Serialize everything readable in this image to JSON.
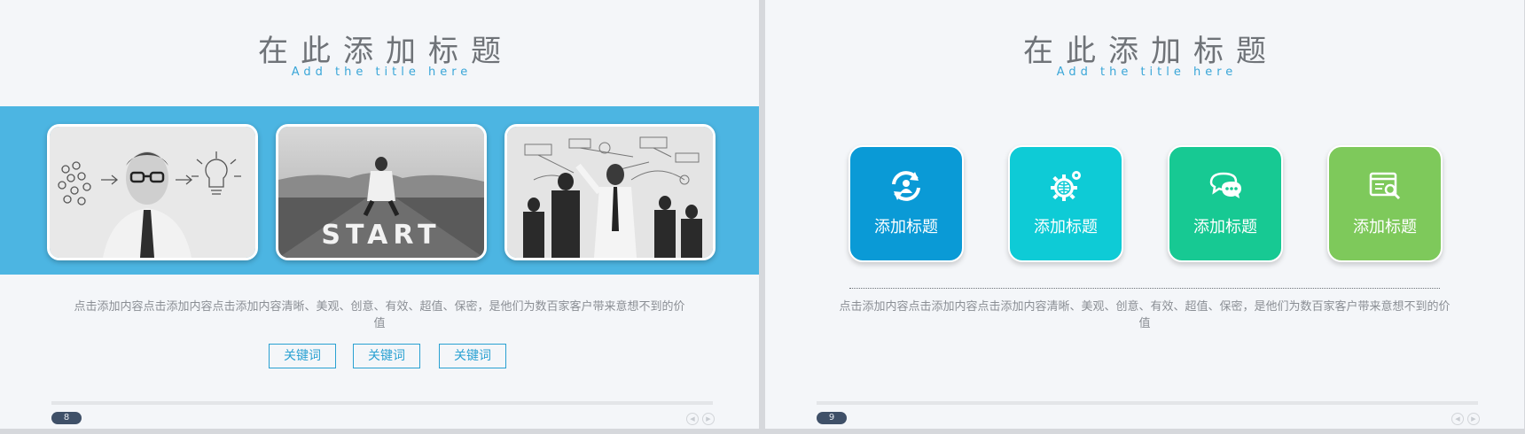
{
  "slides": [
    {
      "page_number": "8",
      "title": "在此添加标题",
      "subtitle": "Add the title here",
      "photos": [
        {
          "name": "man-with-glasses-lightbulb-photo"
        },
        {
          "name": "start-road-runner-photo",
          "text": "START"
        },
        {
          "name": "business-team-whiteboard-photo"
        }
      ],
      "description": "点击添加内容点击添加内容点击添加内容清晰、美观、创意、有效、超值、保密，是他们为数百家客户带来意想不到的价值",
      "keywords": [
        "关键词",
        "关键词",
        "关键词"
      ]
    },
    {
      "page_number": "9",
      "title": "在此添加标题",
      "subtitle": "Add the title here",
      "tiles": [
        {
          "label": "添加标题",
          "icon": "refresh-person-icon",
          "color": "#0a9ad6"
        },
        {
          "label": "添加标题",
          "icon": "gear-globe-icon",
          "color": "#0ecbd6"
        },
        {
          "label": "添加标题",
          "icon": "chat-bubbles-icon",
          "color": "#17c993"
        },
        {
          "label": "添加标题",
          "icon": "search-document-icon",
          "color": "#7ec95b"
        }
      ],
      "description": "点击添加内容点击添加内容点击添加内容清晰、美观、创意、有效、超值、保密，是他们为数百家客户带来意想不到的价值"
    }
  ]
}
